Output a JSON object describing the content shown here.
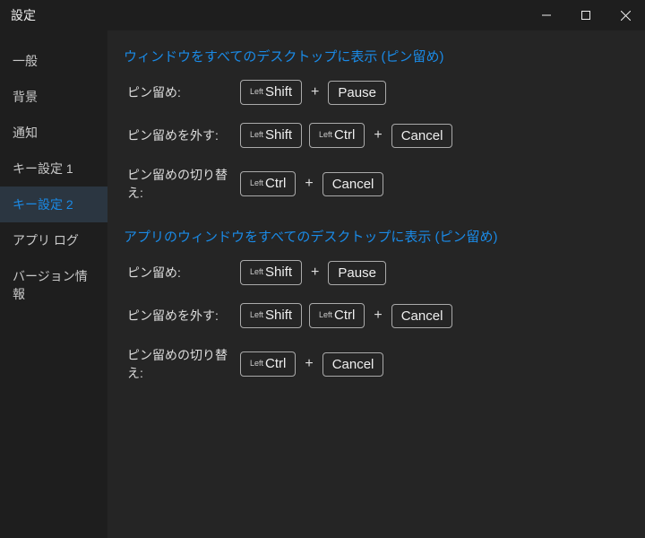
{
  "window": {
    "title": "設定"
  },
  "sidebar": {
    "items": [
      {
        "label": "一般"
      },
      {
        "label": "背景"
      },
      {
        "label": "通知"
      },
      {
        "label": "キー設定 1"
      },
      {
        "label": "キー設定 2"
      },
      {
        "label": "アプリ ログ"
      },
      {
        "label": "バージョン情報"
      }
    ],
    "activeIndex": 4
  },
  "keyParts": {
    "left": "Left",
    "shift": "Shift",
    "ctrl": "Ctrl",
    "pause": "Pause",
    "cancel": "Cancel",
    "plus": "+"
  },
  "sections": [
    {
      "title": "ウィンドウをすべてのデスクトップに表示 (ピン留め)",
      "rows": [
        {
          "label": "ピン留め:",
          "keys": [
            "leftshift",
            "plus",
            "pause"
          ]
        },
        {
          "label": "ピン留めを外す:",
          "keys": [
            "leftshift",
            "leftctrl",
            "plus",
            "cancel"
          ]
        },
        {
          "label": "ピン留めの切り替え:",
          "keys": [
            "leftctrl",
            "plus",
            "cancel"
          ]
        }
      ]
    },
    {
      "title": "アプリのウィンドウをすべてのデスクトップに表示 (ピン留め)",
      "rows": [
        {
          "label": "ピン留め:",
          "keys": [
            "leftshift",
            "plus",
            "pause"
          ]
        },
        {
          "label": "ピン留めを外す:",
          "keys": [
            "leftshift",
            "leftctrl",
            "plus",
            "cancel"
          ]
        },
        {
          "label": "ピン留めの切り替え:",
          "keys": [
            "leftctrl",
            "plus",
            "cancel"
          ]
        }
      ]
    }
  ]
}
